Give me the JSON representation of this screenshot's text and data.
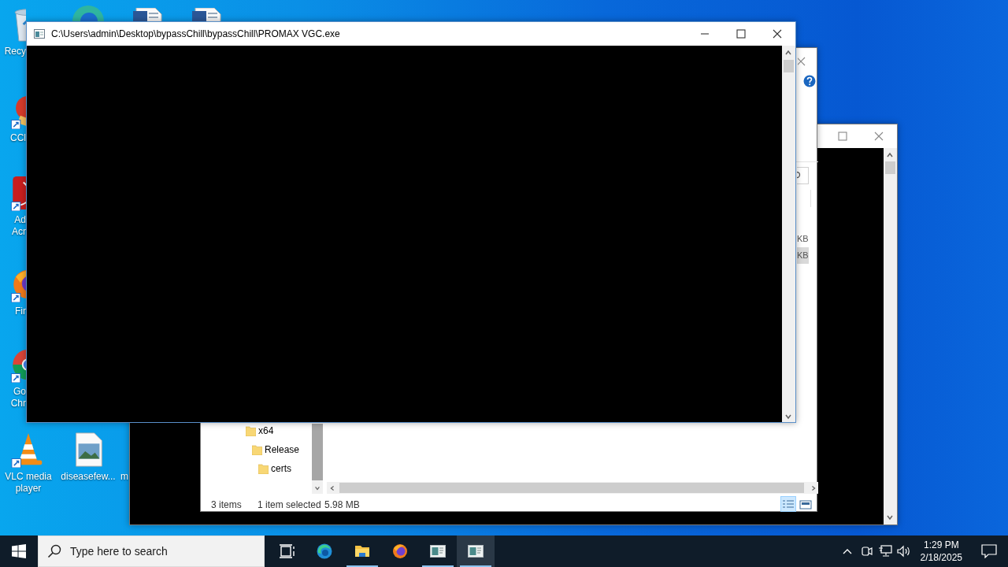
{
  "desktop_icons": [
    {
      "kind": "recycle",
      "cut": true,
      "label_lines": [
        "Recy"
      ]
    },
    {
      "kind": "ccleaner",
      "cut": true,
      "label_lines": [
        "CCl"
      ]
    },
    {
      "kind": "acrobat",
      "cut": true,
      "label_lines": [
        "Ad",
        "Acr"
      ]
    },
    {
      "kind": "firefox",
      "cut": true,
      "label_lines": [
        "Fir"
      ]
    },
    {
      "kind": "chrome",
      "cut": true,
      "label_lines": [
        "Go",
        "Chr"
      ]
    },
    {
      "kind": "vlc",
      "cut": false,
      "label_lines": [
        "VLC media",
        "player"
      ]
    },
    {
      "kind": "image",
      "cut": false,
      "label_lines": [
        "diseasefew..."
      ]
    },
    {
      "kind": "blank",
      "cut": false,
      "label_lines": [
        "m"
      ]
    }
  ],
  "console_back": {
    "kind": "console"
  },
  "explorer": {
    "tree_items": [
      {
        "label": "x64",
        "children": [
          {
            "label": "Release",
            "children": [
              {
                "label": "certs"
              }
            ]
          }
        ]
      }
    ],
    "size_cells": [
      {
        "text": "KB",
        "selected": false
      },
      {
        "text": "KB",
        "selected": true
      }
    ],
    "status_bar": {
      "item_count": "3 items",
      "selection": "1 item selected",
      "size": "5.98 MB"
    },
    "views": [
      {
        "kind": "details",
        "selected": true
      },
      {
        "kind": "preview",
        "selected": false
      }
    ]
  },
  "console_front": {
    "title": "C:\\Users\\admin\\Desktop\\bypassChill\\bypassChill\\PROMAX VGC.exe"
  },
  "taskbar": {
    "search": {
      "placeholder": "Type here to search"
    },
    "apps": [
      {
        "kind": "taskview",
        "running": false,
        "selected": false
      },
      {
        "kind": "edge",
        "running": false,
        "selected": false
      },
      {
        "kind": "explorer",
        "running": true,
        "selected": false
      },
      {
        "kind": "firefox",
        "running": false,
        "selected": false
      },
      {
        "kind": "console",
        "running": true,
        "selected": false
      },
      {
        "kind": "console",
        "running": true,
        "selected": true
      }
    ],
    "tray": {
      "time": "1:29 PM",
      "date": "2/18/2025"
    }
  }
}
